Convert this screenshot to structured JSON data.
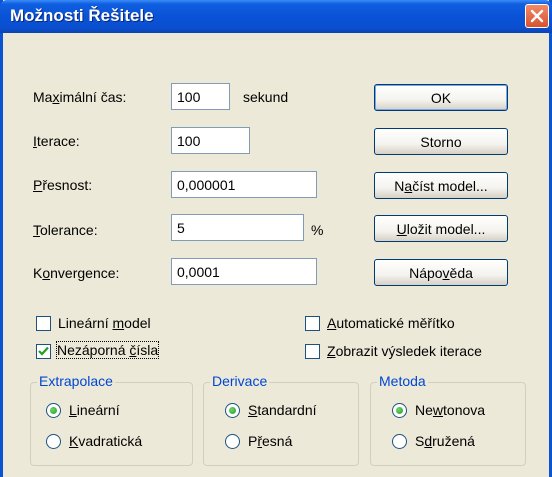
{
  "window": {
    "title": "Možnosti Řešitele",
    "accent_color": "#0a54d4",
    "close_icon": "close-icon"
  },
  "fields": {
    "max_time": {
      "label_pre": "Ma",
      "label_u": "x",
      "label_post": "imální čas:",
      "value": "100",
      "unit": "sekund"
    },
    "iterations": {
      "label_u": "I",
      "label_post": "terace:",
      "value": "100"
    },
    "precision": {
      "label_u": "P",
      "label_post": "řesnost:",
      "value": "0,000001"
    },
    "tolerance": {
      "label_u": "T",
      "label_post": "olerance:",
      "value": "5",
      "unit": "%"
    },
    "convergence": {
      "label_pre": "K",
      "label_u": "o",
      "label_post": "nvergence:",
      "value": "0,0001"
    }
  },
  "buttons": {
    "ok": "OK",
    "cancel": "Storno",
    "load_pre": "N",
    "load_u": "a",
    "load_post": "číst model...",
    "save_u": "U",
    "save_post": "ložit model...",
    "help_pre": "Nápo",
    "help_u": "v",
    "help_post": "ěda"
  },
  "checkboxes": {
    "linear_model": {
      "pre": "Lineární ",
      "u": "m",
      "post": "odel",
      "checked": false
    },
    "auto_scale": {
      "u": "A",
      "post": "utomatické měřítko",
      "checked": false
    },
    "non_negative": {
      "pre": "Nezáporná ",
      "u": "č",
      "post": "ísla",
      "checked": true
    },
    "show_iteration": {
      "u": "Z",
      "post": "obrazit výsledek iterace",
      "checked": false
    }
  },
  "groups": {
    "extrapolation": {
      "title": "Extrapolace",
      "opt1": {
        "u": "L",
        "post": "ineární",
        "selected": true
      },
      "opt2": {
        "u": "K",
        "post": "vadratická",
        "selected": false
      }
    },
    "derivatives": {
      "title": "Derivace",
      "opt1": {
        "u": "S",
        "post": "tandardní",
        "selected": true
      },
      "opt2": {
        "pre": "P",
        "u": "ř",
        "post": "esná",
        "selected": false
      }
    },
    "method": {
      "title": "Metoda",
      "opt1": {
        "pre": "Ne",
        "u": "w",
        "post": "tonova",
        "selected": true
      },
      "opt2": {
        "pre": "S",
        "u": "d",
        "post": "ružená",
        "selected": false
      }
    }
  }
}
